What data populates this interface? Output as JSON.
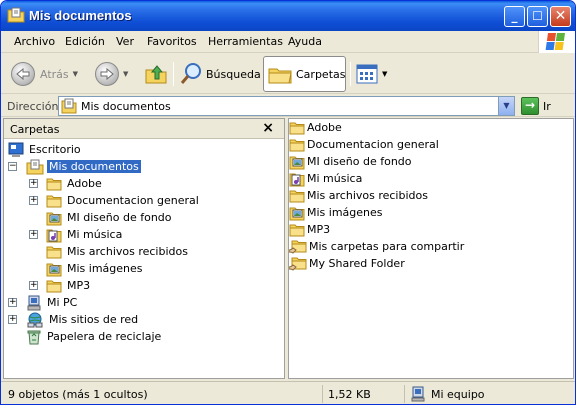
{
  "window": {
    "title": "Mis documentos"
  },
  "menubar": {
    "items": [
      "Archivo",
      "Edición",
      "Ver",
      "Favoritos",
      "Herramientas",
      "Ayuda"
    ]
  },
  "toolbar": {
    "back_label": "Atrás",
    "search_label": "Búsqueda",
    "folders_label": "Carpetas"
  },
  "addressbar": {
    "label": "Dirección",
    "value": "Mis documentos",
    "go_label": "Ir"
  },
  "folderpane": {
    "title": "Carpetas",
    "tree": [
      {
        "label": "Escritorio",
        "icon": "desktop-icon"
      },
      {
        "label": "Mis documentos",
        "icon": "my-documents-icon",
        "selected": true
      },
      {
        "label": "Adobe",
        "icon": "folder-icon"
      },
      {
        "label": "Documentacion general",
        "icon": "folder-icon"
      },
      {
        "label": "MI diseño de fondo",
        "icon": "picture-folder-icon"
      },
      {
        "label": "Mi música",
        "icon": "music-folder-icon"
      },
      {
        "label": "Mis archivos recibidos",
        "icon": "folder-icon"
      },
      {
        "label": "Mis imágenes",
        "icon": "picture-folder-icon"
      },
      {
        "label": "MP3",
        "icon": "folder-icon"
      },
      {
        "label": "Mi PC",
        "icon": "my-computer-icon"
      },
      {
        "label": "Mis sitios de red",
        "icon": "network-places-icon"
      },
      {
        "label": "Papelera de reciclaje",
        "icon": "recycle-bin-icon"
      }
    ]
  },
  "filepane": {
    "files": [
      {
        "name": "Adobe",
        "icon": "folder-icon"
      },
      {
        "name": "Documentacion general",
        "icon": "folder-icon"
      },
      {
        "name": "MI diseño de fondo",
        "icon": "picture-folder-icon"
      },
      {
        "name": "Mi música",
        "icon": "music-folder-icon"
      },
      {
        "name": "Mis archivos recibidos",
        "icon": "folder-icon"
      },
      {
        "name": "Mis imágenes",
        "icon": "picture-folder-icon"
      },
      {
        "name": "MP3",
        "icon": "folder-icon"
      },
      {
        "name": "Mis carpetas para compartir",
        "icon": "shared-folder-icon"
      },
      {
        "name": "My Shared Folder",
        "icon": "shared-folder-icon"
      }
    ]
  },
  "statusbar": {
    "objects": "9 objetos (más 1 ocultos)",
    "size": "1,52 KB",
    "location": "Mi equipo"
  },
  "colors": {
    "title_blue": "#0b46c6",
    "selection": "#316ac5",
    "chrome": "#ece9d8",
    "folder_yellow": "#f4d35e"
  }
}
